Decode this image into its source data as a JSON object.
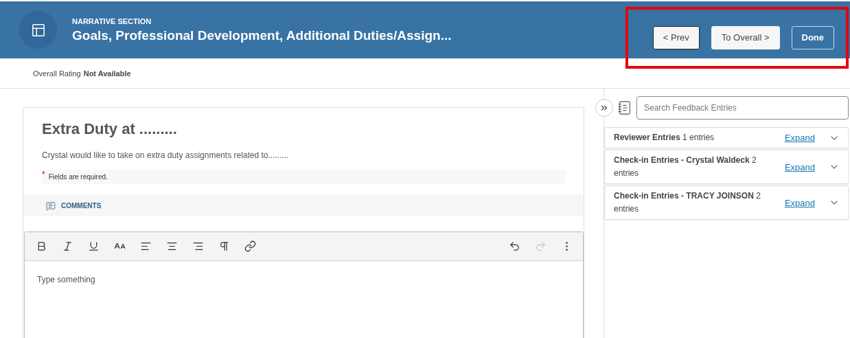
{
  "header": {
    "eyebrow": "NARRATIVE SECTION",
    "title": "Goals, Professional Development, Additional Duties/Assign...",
    "buttons": [
      {
        "label": "< Prev",
        "kind": "outlined-light",
        "focused": true
      },
      {
        "label": "To Overall >",
        "kind": "light",
        "focused": false
      },
      {
        "label": "Done",
        "kind": "outline",
        "focused": false
      }
    ],
    "highlighted": true
  },
  "rating": {
    "label": "Overall Rating",
    "value": "Not Available"
  },
  "goal": {
    "title": "Extra Duty at .........",
    "description": "Crystal would like to take on extra duty assignments related to.........",
    "required_mark": "*",
    "required_note": "Fields are required.",
    "comments": "COMMENTS"
  },
  "editor": {
    "placeholder": "Type something",
    "tools": [
      {
        "kind": "bold",
        "disabled": false
      },
      {
        "kind": "italic",
        "disabled": false
      },
      {
        "kind": "underline",
        "disabled": false
      },
      {
        "kind": "font-size",
        "disabled": false
      },
      {
        "kind": "align-left",
        "disabled": false
      },
      {
        "kind": "align-center",
        "disabled": false
      },
      {
        "kind": "align-right",
        "disabled": false
      },
      {
        "kind": "paragraph",
        "disabled": false
      },
      {
        "kind": "link",
        "disabled": false
      }
    ],
    "history_tools": [
      {
        "kind": "undo",
        "disabled": false
      },
      {
        "kind": "redo",
        "disabled": true
      },
      {
        "kind": "more",
        "disabled": false
      }
    ]
  },
  "feedback": {
    "search_placeholder": "Search Feedback Entries",
    "entries": [
      {
        "name": "Reviewer Entries",
        "count": "1 entries",
        "action": "Expand"
      },
      {
        "name": "Check-in Entries - Crystal Waldeck",
        "count": "2 entries",
        "action": "Expand"
      },
      {
        "name": "Check-in Entries - TRACY JOINSON",
        "count": "2 entries",
        "action": "Expand"
      }
    ]
  }
}
